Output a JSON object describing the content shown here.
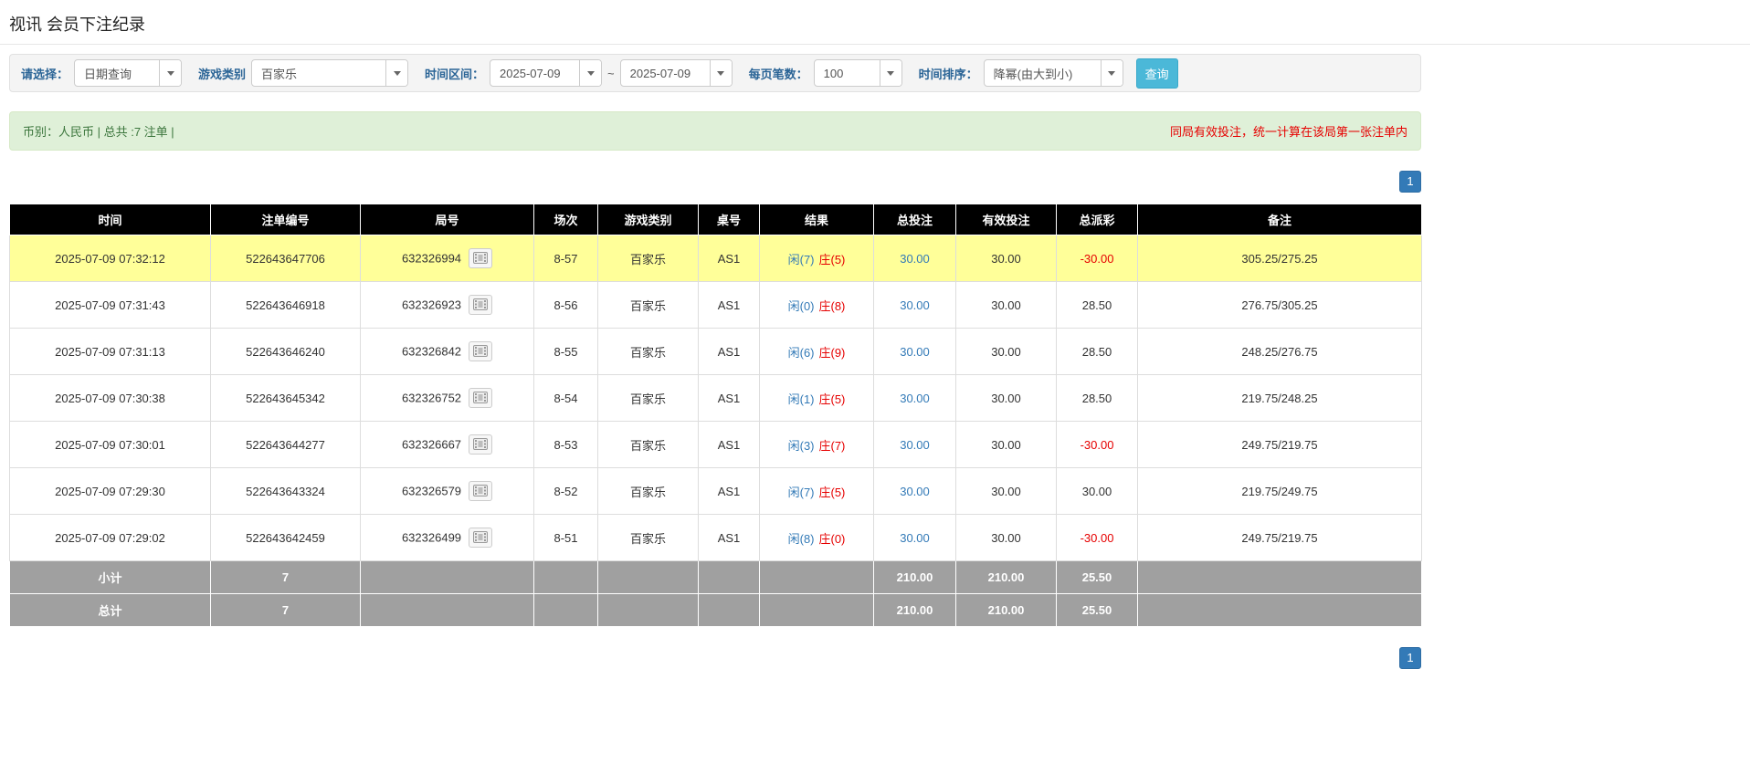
{
  "page": {
    "title": "视讯 会员下注纪录"
  },
  "filters": {
    "query_type": {
      "label": "请选择：",
      "value": "日期查询"
    },
    "game_type": {
      "label": "游戏类别",
      "value": "百家乐"
    },
    "time_range": {
      "label": "时间区间：",
      "from": "2025-07-09",
      "separator": "~",
      "to": "2025-07-09"
    },
    "page_size": {
      "label": "每页笔数：",
      "value": "100"
    },
    "sort": {
      "label": "时间排序：",
      "value": "降幂(由大到小)"
    },
    "search_button": "查询"
  },
  "summary": {
    "currency_info": "币别：人民币 | 总共 :7 注单 |",
    "note": "同局有效投注，统一计算在该局第一张注单内"
  },
  "pagination": {
    "page": "1"
  },
  "icons": {
    "video_replay": "video-replay-icon",
    "chevron_down": "chevron-down-icon"
  },
  "colors": {
    "accent_blue": "#337ab7",
    "banker_red": "#e60000",
    "highlight_yellow": "#ffff99",
    "header_black": "#000000",
    "footer_gray": "#a0a0a0",
    "success_bg": "#dff0d8"
  },
  "table": {
    "headers": [
      "时间",
      "注单编号",
      "局号",
      "场次",
      "游戏类别",
      "桌号",
      "结果",
      "总投注",
      "有效投注",
      "总派彩",
      "备注"
    ],
    "rows": [
      {
        "time": "2025-07-09 07:32:12",
        "bet_id": "522643647706",
        "round_id": "632326994",
        "session": "8-57",
        "game": "百家乐",
        "table_no": "AS1",
        "player": "闲(7)",
        "banker": "庄(5)",
        "total_bet": "30.00",
        "valid_bet": "30.00",
        "payout": "-30.00",
        "remark": "305.25/275.25",
        "highlight": true
      },
      {
        "time": "2025-07-09 07:31:43",
        "bet_id": "522643646918",
        "round_id": "632326923",
        "session": "8-56",
        "game": "百家乐",
        "table_no": "AS1",
        "player": "闲(0)",
        "banker": "庄(8)",
        "total_bet": "30.00",
        "valid_bet": "30.00",
        "payout": "28.50",
        "remark": "276.75/305.25",
        "highlight": false
      },
      {
        "time": "2025-07-09 07:31:13",
        "bet_id": "522643646240",
        "round_id": "632326842",
        "session": "8-55",
        "game": "百家乐",
        "table_no": "AS1",
        "player": "闲(6)",
        "banker": "庄(9)",
        "total_bet": "30.00",
        "valid_bet": "30.00",
        "payout": "28.50",
        "remark": "248.25/276.75",
        "highlight": false
      },
      {
        "time": "2025-07-09 07:30:38",
        "bet_id": "522643645342",
        "round_id": "632326752",
        "session": "8-54",
        "game": "百家乐",
        "table_no": "AS1",
        "player": "闲(1)",
        "banker": "庄(5)",
        "total_bet": "30.00",
        "valid_bet": "30.00",
        "payout": "28.50",
        "remark": "219.75/248.25",
        "highlight": false
      },
      {
        "time": "2025-07-09 07:30:01",
        "bet_id": "522643644277",
        "round_id": "632326667",
        "session": "8-53",
        "game": "百家乐",
        "table_no": "AS1",
        "player": "闲(3)",
        "banker": "庄(7)",
        "total_bet": "30.00",
        "valid_bet": "30.00",
        "payout": "-30.00",
        "remark": "249.75/219.75",
        "highlight": false
      },
      {
        "time": "2025-07-09 07:29:30",
        "bet_id": "522643643324",
        "round_id": "632326579",
        "session": "8-52",
        "game": "百家乐",
        "table_no": "AS1",
        "player": "闲(7)",
        "banker": "庄(5)",
        "total_bet": "30.00",
        "valid_bet": "30.00",
        "payout": "30.00",
        "remark": "219.75/249.75",
        "highlight": false
      },
      {
        "time": "2025-07-09 07:29:02",
        "bet_id": "522643642459",
        "round_id": "632326499",
        "session": "8-51",
        "game": "百家乐",
        "table_no": "AS1",
        "player": "闲(8)",
        "banker": "庄(0)",
        "total_bet": "30.00",
        "valid_bet": "30.00",
        "payout": "-30.00",
        "remark": "249.75/219.75",
        "highlight": false
      }
    ],
    "subtotal": {
      "label": "小计",
      "count": "7",
      "total_bet": "210.00",
      "valid_bet": "210.00",
      "payout": "25.50"
    },
    "total": {
      "label": "总计",
      "count": "7",
      "total_bet": "210.00",
      "valid_bet": "210.00",
      "payout": "25.50"
    }
  }
}
